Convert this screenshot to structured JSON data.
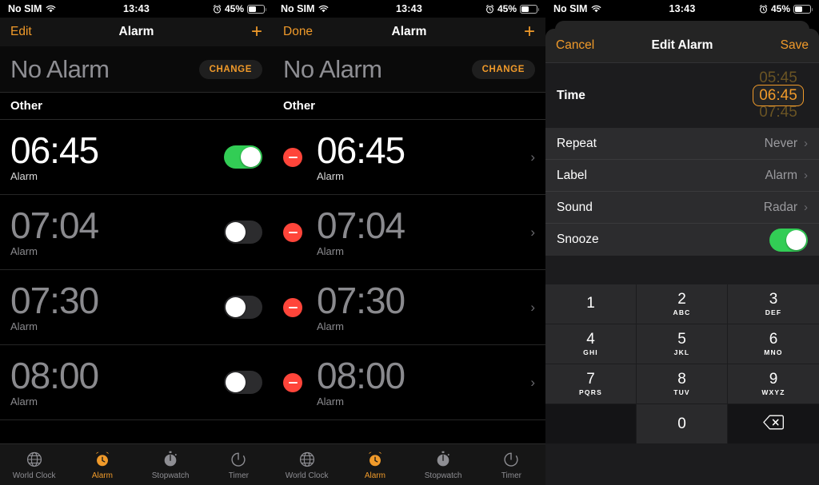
{
  "status_bar": {
    "carrier": "No SIM",
    "time": "13:43",
    "battery_percent": "45%",
    "wifi_icon": "wifi-icon",
    "alarm_icon": "alarm-clock-icon",
    "battery_icon": "battery-icon"
  },
  "panel1": {
    "nav": {
      "left_label": "Edit",
      "title": "Alarm",
      "add_icon": "plus-icon"
    },
    "banner": {
      "text": "No Alarm",
      "button_label": "CHANGE"
    },
    "section_title": "Other",
    "alarms": [
      {
        "time": "06:45",
        "label": "Alarm",
        "enabled": true
      },
      {
        "time": "07:04",
        "label": "Alarm",
        "enabled": false
      },
      {
        "time": "07:30",
        "label": "Alarm",
        "enabled": false
      },
      {
        "time": "08:00",
        "label": "Alarm",
        "enabled": false
      }
    ]
  },
  "panel2": {
    "nav": {
      "left_label": "Done",
      "title": "Alarm",
      "add_icon": "plus-icon"
    },
    "banner": {
      "text": "No Alarm",
      "button_label": "CHANGE"
    },
    "section_title": "Other",
    "alarms": [
      {
        "time": "06:45",
        "label": "Alarm",
        "enabled": true
      },
      {
        "time": "07:04",
        "label": "Alarm",
        "enabled": false
      },
      {
        "time": "07:30",
        "label": "Alarm",
        "enabled": false
      },
      {
        "time": "08:00",
        "label": "Alarm",
        "enabled": false
      }
    ]
  },
  "panel3": {
    "nav": {
      "cancel_label": "Cancel",
      "title": "Edit Alarm",
      "save_label": "Save"
    },
    "time_row": {
      "label": "Time",
      "value": "06:45",
      "ghost_above": "05:45",
      "ghost_below": "07:45"
    },
    "settings": [
      {
        "label": "Repeat",
        "value": "Never",
        "type": "disclosure"
      },
      {
        "label": "Label",
        "value": "Alarm",
        "type": "disclosure"
      },
      {
        "label": "Sound",
        "value": "Radar",
        "type": "disclosure"
      },
      {
        "label": "Snooze",
        "value": "on",
        "type": "toggle"
      }
    ],
    "keypad": [
      {
        "num": "1",
        "sub": ""
      },
      {
        "num": "2",
        "sub": "ABC"
      },
      {
        "num": "3",
        "sub": "DEF"
      },
      {
        "num": "4",
        "sub": "GHI"
      },
      {
        "num": "5",
        "sub": "JKL"
      },
      {
        "num": "6",
        "sub": "MNO"
      },
      {
        "num": "7",
        "sub": "PQRS"
      },
      {
        "num": "8",
        "sub": "TUV"
      },
      {
        "num": "9",
        "sub": "WXYZ"
      },
      {
        "num": "",
        "sub": ""
      },
      {
        "num": "0",
        "sub": ""
      },
      {
        "num": "backspace-icon",
        "sub": ""
      }
    ]
  },
  "tabbar": {
    "items": [
      {
        "label": "World Clock",
        "icon": "globe-icon",
        "active": false
      },
      {
        "label": "Alarm",
        "icon": "alarm-clock-icon",
        "active": true
      },
      {
        "label": "Stopwatch",
        "icon": "stopwatch-icon",
        "active": false
      },
      {
        "label": "Timer",
        "icon": "timer-icon",
        "active": false
      }
    ]
  },
  "colors": {
    "accent": "#f09a2a",
    "toggle_on": "#32cd55",
    "delete_red": "#ff453a",
    "background": "#000000"
  }
}
